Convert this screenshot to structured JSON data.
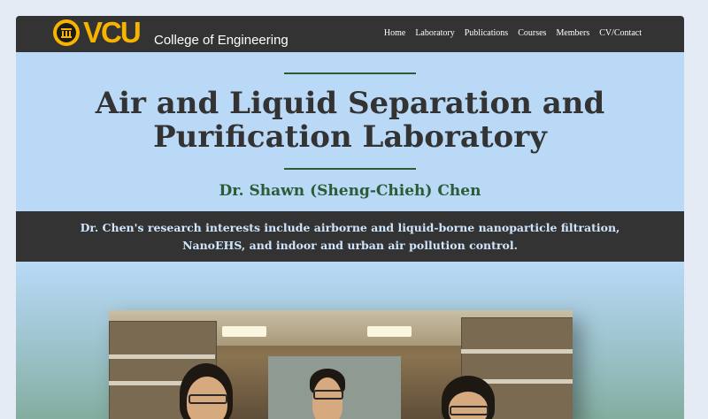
{
  "header": {
    "logo_text": "VCU",
    "logo_subtitle": "College of Engineering",
    "nav": [
      "Home",
      "Laboratory",
      "Publications",
      "Courses",
      "Members",
      "CV/Contact"
    ]
  },
  "hero": {
    "title_line1": "Air and Liquid Separation and",
    "title_line2": "Purification Laboratory",
    "subtitle": "Dr. Shawn (Sheng-Chieh) Chen"
  },
  "band": {
    "line1": "Dr. Chen's research interests include airborne and liquid-borne nanoparticle filtration,",
    "line2": "NanoEHS, and indoor and urban air pollution control."
  },
  "colors": {
    "navbar": "#333333",
    "vcu_gold": "#f8b300",
    "hero_bg": "#b9d9f6",
    "accent_green": "#2e5a36",
    "band_text": "#cfe5fb"
  },
  "icons": {
    "logo": "vcu-seal-icon"
  }
}
